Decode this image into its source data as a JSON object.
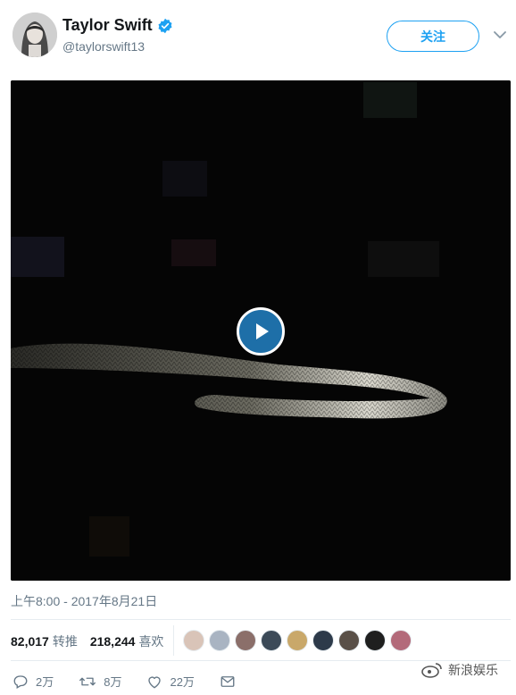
{
  "user": {
    "display_name": "Taylor Swift",
    "handle": "@taylorswift13",
    "verified_icon": "verified-badge-icon",
    "follow_label": "关注"
  },
  "media": {
    "type": "video",
    "play_icon": "play-icon"
  },
  "timestamp": "上午8:00 - 2017年8月21日",
  "stats": {
    "retweets_count": "82,017",
    "retweets_label": "转推",
    "likes_count": "218,244",
    "likes_label": "喜欢",
    "liker_avatar_count": 9
  },
  "actions": {
    "reply_count": "2万",
    "retweet_count": "8万",
    "like_count": "22万"
  },
  "watermark": {
    "text": "新浪娱乐"
  },
  "colors": {
    "accent": "#1da1f2",
    "secondary_text": "#657786",
    "play_button": "#1e6fa8"
  }
}
